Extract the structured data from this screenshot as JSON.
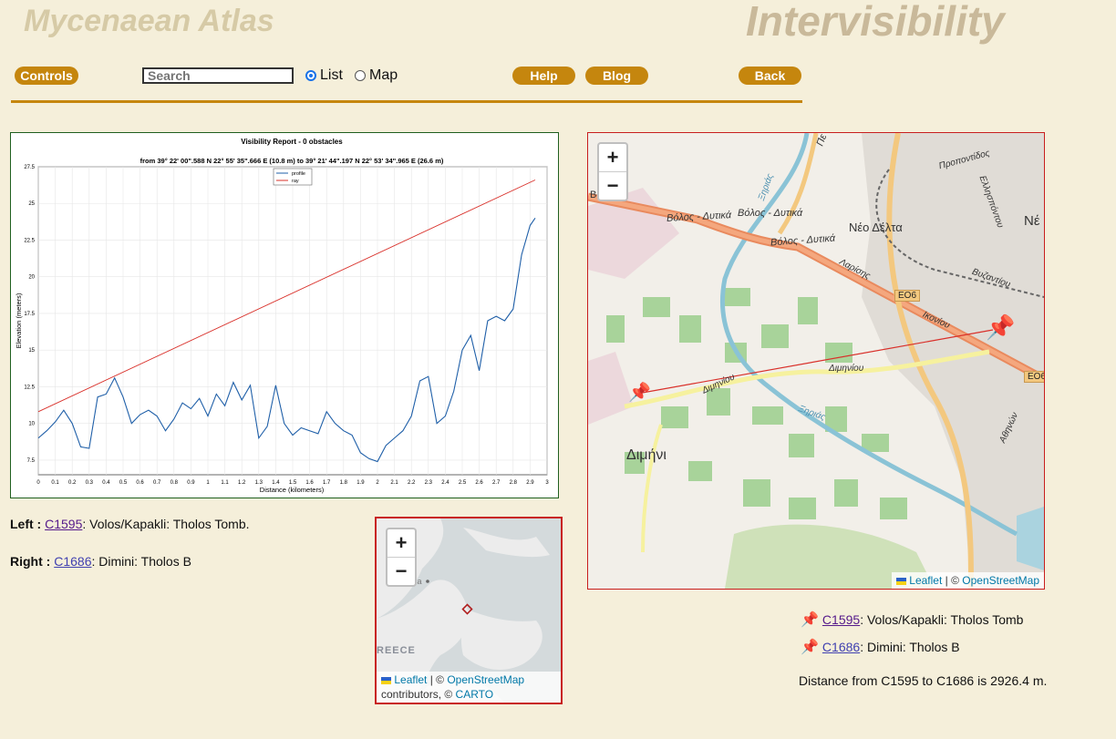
{
  "header": {
    "site_title": "Mycenaean Atlas",
    "page_title": "Intervisibility"
  },
  "toolbar": {
    "controls": "Controls",
    "search_placeholder": "Search",
    "list_label": "List",
    "map_label": "Map",
    "selected_view": "List",
    "help": "Help",
    "blog": "Blog",
    "back": "Back"
  },
  "chart_data": {
    "type": "line",
    "title": "Visibility Report - 0 obstacles",
    "subtitle": "from 39° 22' 00\".588 N 22° 55' 35\".666 E (10.8 m) to 39° 21' 44\".197 N 22° 53' 34\".965 E (26.6 m)",
    "xlabel": "Distance (kilometers)",
    "ylabel": "Elevation (meters)",
    "xlim": [
      0,
      3
    ],
    "ylim": [
      6.5,
      27.5
    ],
    "xticks": [
      "0",
      "0.1",
      "0.2",
      "0.3",
      "0.4",
      "0.5",
      "0.6",
      "0.7",
      "0.8",
      "0.9",
      "1",
      "1.1",
      "1.2",
      "1.3",
      "1.4",
      "1.5",
      "1.6",
      "1.7",
      "1.8",
      "1.9",
      "2",
      "2.1",
      "2.2",
      "2.3",
      "2.4",
      "2.5",
      "2.6",
      "2.7",
      "2.8",
      "2.9",
      "3"
    ],
    "yticks": [
      "7.5",
      "10",
      "12.5",
      "15",
      "17.5",
      "20",
      "22.5",
      "25",
      "27.5"
    ],
    "ytick_values": [
      7.5,
      10,
      12.5,
      15,
      17.5,
      20,
      22.5,
      25,
      27.5
    ],
    "legend": [
      "profile",
      "ray"
    ],
    "legend_position": "top-center",
    "grid": true,
    "series": [
      {
        "name": "profile",
        "color": "#1f5fa8",
        "x": [
          0,
          0.05,
          0.1,
          0.15,
          0.2,
          0.25,
          0.3,
          0.35,
          0.4,
          0.45,
          0.5,
          0.55,
          0.6,
          0.65,
          0.7,
          0.75,
          0.8,
          0.85,
          0.9,
          0.95,
          1.0,
          1.05,
          1.1,
          1.15,
          1.2,
          1.25,
          1.3,
          1.35,
          1.4,
          1.45,
          1.5,
          1.55,
          1.6,
          1.65,
          1.7,
          1.75,
          1.8,
          1.85,
          1.9,
          1.95,
          2.0,
          2.05,
          2.1,
          2.15,
          2.2,
          2.25,
          2.3,
          2.35,
          2.4,
          2.45,
          2.5,
          2.55,
          2.6,
          2.65,
          2.7,
          2.75,
          2.8,
          2.85,
          2.9,
          2.93
        ],
        "values": [
          9,
          9.5,
          10.1,
          10.9,
          10.0,
          8.4,
          8.3,
          11.8,
          12.0,
          13.1,
          11.8,
          10.0,
          10.6,
          10.9,
          10.5,
          9.5,
          10.3,
          11.4,
          11.0,
          11.7,
          10.5,
          12.0,
          11.2,
          12.8,
          11.6,
          12.6,
          9.0,
          9.8,
          12.6,
          10.0,
          9.2,
          9.7,
          9.5,
          9.3,
          10.8,
          10.0,
          9.5,
          9.2,
          8.0,
          7.6,
          7.4,
          8.5,
          9.0,
          9.5,
          10.5,
          12.9,
          13.2,
          10.0,
          10.5,
          12.2,
          15.0,
          16.0,
          13.6,
          17.0,
          17.3,
          17.0,
          17.8,
          21.5,
          23.5,
          24.0
        ]
      },
      {
        "name": "ray",
        "color": "#d9302a",
        "x": [
          0,
          2.93
        ],
        "values": [
          10.8,
          26.6
        ]
      }
    ]
  },
  "sites": {
    "left_label": "Left :",
    "left_id": "C1595",
    "left_desc": ": Volos/Kapakli: Tholos Tomb.",
    "right_label": "Right :",
    "right_id": "C1686",
    "right_desc": ": Dimini: Tholos B"
  },
  "mini_map": {
    "zoom_in": "+",
    "zoom_out": "−",
    "country_label": "REECE",
    "town_label": "sa",
    "leaflet": "Leaflet",
    "sep": " | © ",
    "osm": "OpenStreetMap",
    "contributors": "contributors, © ",
    "carto": "CARTO"
  },
  "big_map": {
    "zoom_in": "+",
    "zoom_out": "−",
    "labels": {
      "road_volos_1": "Βόλος - Δυτικά",
      "road_volos_2": "Βόλος - Δυτικά",
      "road_volos_3": "Βόλος - Δυτικά",
      "neo_delta": "Νέο Δέλτα",
      "larisis": "Λαρίσης",
      "eo6_a": "ΕΟ6",
      "eo6_b": "ΕΟ6",
      "diminiou_1": "Διμηνίου",
      "diminiou_2": "Διμηνίου",
      "dimini": "Διμήνι",
      "proponitidos": "Προποντίδος",
      "ellispontou": "Ελλησπόντου",
      "vyzantiou": "Βυζαντίου",
      "ne": "Νέ",
      "ikonion": "Ικονίου",
      "athinon": "Αθηνών",
      "ksirias_1": "Ξηριάς",
      "ksirias_2": "Ξηριάς",
      "vo": "Βο",
      "pe": "Πε"
    },
    "leaflet": "Leaflet",
    "sep": " | © ",
    "osm": "OpenStreetMap"
  },
  "legend": {
    "c1595_id": "C1595",
    "c1595_desc": ": Volos/Kapakli: Tholos Tomb",
    "c1686_id": "C1686",
    "c1686_desc": ": Dimini: Tholos B",
    "distance": "Distance from C1595 to C1686 is 2926.4 m."
  }
}
